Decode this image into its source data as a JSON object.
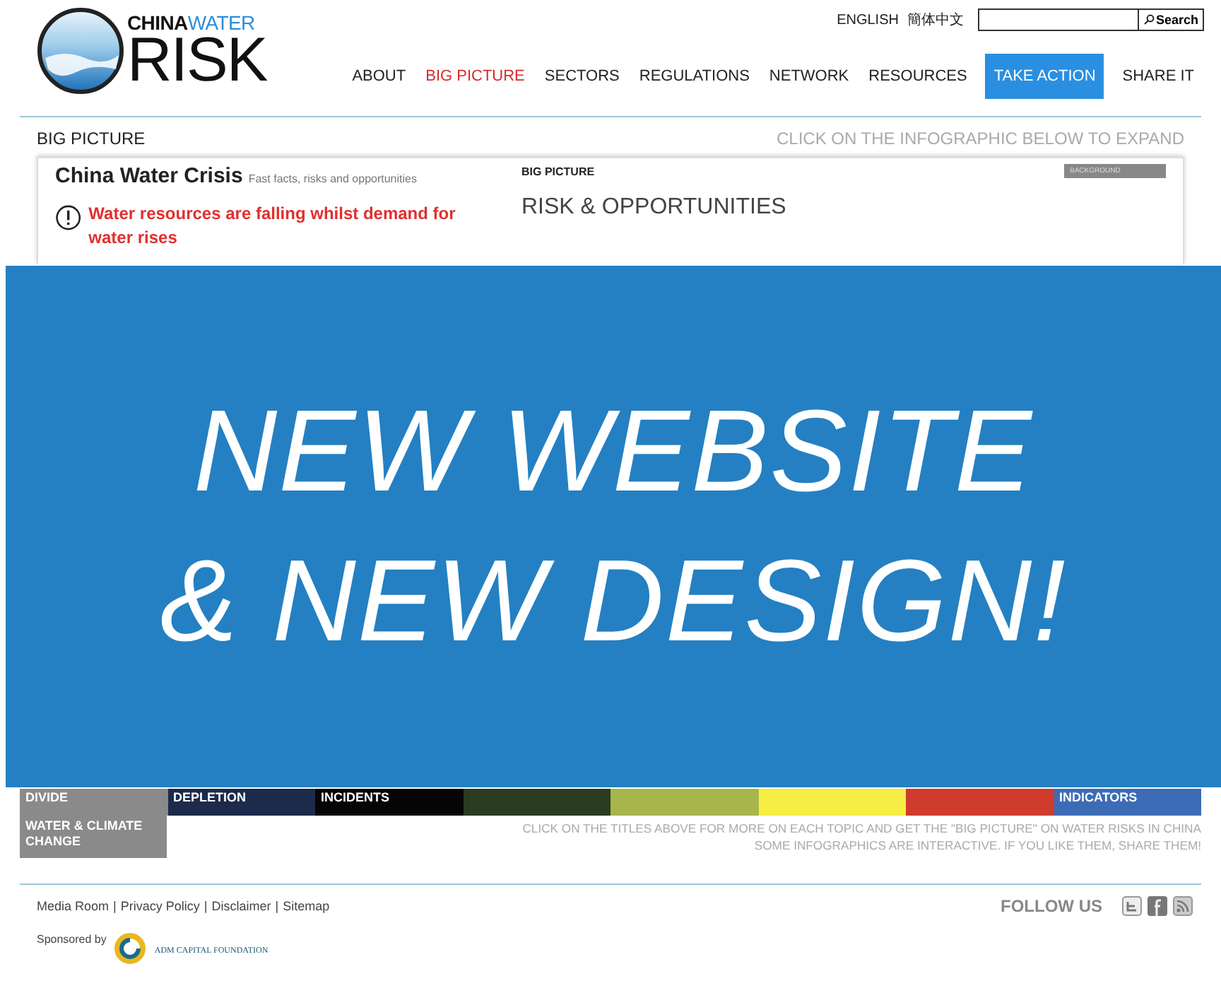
{
  "logo": {
    "word_1": "CHINA",
    "word_2": "WATER",
    "word_3": "RISK"
  },
  "languages": [
    "ENGLISH",
    "簡体中文"
  ],
  "search": {
    "button": "Search"
  },
  "nav": [
    {
      "label": "ABOUT",
      "selected": false,
      "kind": "link"
    },
    {
      "label": "BIG PICTURE",
      "selected": true,
      "kind": "link"
    },
    {
      "label": "SECTORS",
      "selected": false,
      "kind": "link"
    },
    {
      "label": "REGULATIONS",
      "selected": false,
      "kind": "link"
    },
    {
      "label": "NETWORK",
      "selected": false,
      "kind": "link"
    },
    {
      "label": "RESOURCES",
      "selected": false,
      "kind": "link"
    },
    {
      "label": "TAKE ACTION",
      "selected": false,
      "kind": "cta"
    },
    {
      "label": "SHARE IT",
      "selected": false,
      "kind": "link"
    }
  ],
  "section": {
    "title": "BIG PICTURE",
    "hint": "CLICK ON THE INFOGRAPHIC BELOW TO EXPAND"
  },
  "infographic": {
    "title": "China Water Crisis",
    "subtitle": "Fast facts, risks and opportunities",
    "label": "BIG PICTURE",
    "tab": "BACKGROUND",
    "alert": "Water resources are falling whilst demand for water rises",
    "heading": "RISK & OPPORTUNITIES"
  },
  "grid_bottom_row": [
    {
      "text": "DIVIDE",
      "color": "#8a8a8a"
    },
    {
      "text": "DEPLETION",
      "color": "#1c2b4c"
    },
    {
      "text": "INCIDENTS",
      "color": "#050505"
    },
    {
      "color": "#2a3b22"
    },
    {
      "color": "#a6b64c"
    },
    {
      "color": "#f6ee44"
    },
    {
      "color": "#cf3b2c"
    },
    {
      "text": "INDICATORS",
      "color": "#3c6cb6"
    }
  ],
  "extra_cell": {
    "text": "WATER & CLIMATE CHANGE",
    "color": "#8a8a8a"
  },
  "instructions": [
    "CLICK ON THE TITLES ABOVE FOR MORE ON EACH TOPIC AND GET THE \"BIG PICTURE\" ON WATER RISKS IN CHINA",
    "SOME INFOGRAPHICS ARE INTERACTIVE. IF YOU LIKE THEM, SHARE THEM!"
  ],
  "footer": {
    "links": [
      "Media Room",
      "Privacy Policy",
      "Disclaimer",
      "Sitemap"
    ],
    "separator": "|",
    "follow": "FOLLOW US",
    "sponsored": "Sponsored by",
    "sponsor": "ADM CAPITAL FOUNDATION"
  },
  "banner": {
    "lines": [
      "NEW WEBSITE",
      "& NEW DESIGN!"
    ]
  }
}
